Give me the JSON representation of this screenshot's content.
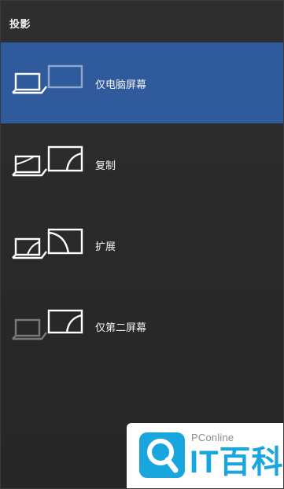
{
  "panel": {
    "title": "投影"
  },
  "options": [
    {
      "label": "仅电脑屏幕",
      "selected": true,
      "icon": "pc-screen-only-icon"
    },
    {
      "label": "复制",
      "selected": false,
      "icon": "duplicate-icon"
    },
    {
      "label": "扩展",
      "selected": false,
      "icon": "extend-icon"
    },
    {
      "label": "仅第二屏幕",
      "selected": false,
      "icon": "second-screen-only-icon"
    }
  ],
  "watermark": {
    "site": "PConline",
    "brand": "IT百科",
    "icon": "magnifier-logo-icon"
  },
  "colors": {
    "background": "#2b2b2b",
    "selected": "#2f5a9c",
    "watermark_accent": "#19a6df"
  }
}
